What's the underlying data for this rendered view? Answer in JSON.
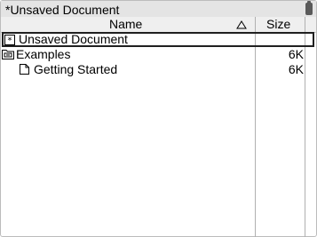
{
  "window": {
    "title": "*Unsaved Document"
  },
  "columns": {
    "name": "Name",
    "size": "Size"
  },
  "files": [
    {
      "name": "Unsaved Document",
      "size": "",
      "icon": "tns-document-icon",
      "selected": true,
      "indent": 0
    },
    {
      "name": "Examples",
      "size": "6K",
      "icon": "folder-open-icon",
      "selected": false,
      "indent": 0
    },
    {
      "name": "Getting Started",
      "size": "6K",
      "icon": "document-icon",
      "selected": false,
      "indent": 1
    }
  ],
  "colors": {
    "title_bar": "#e4e4e4",
    "header_bg": "#efefef",
    "selection_border": "#202020"
  }
}
